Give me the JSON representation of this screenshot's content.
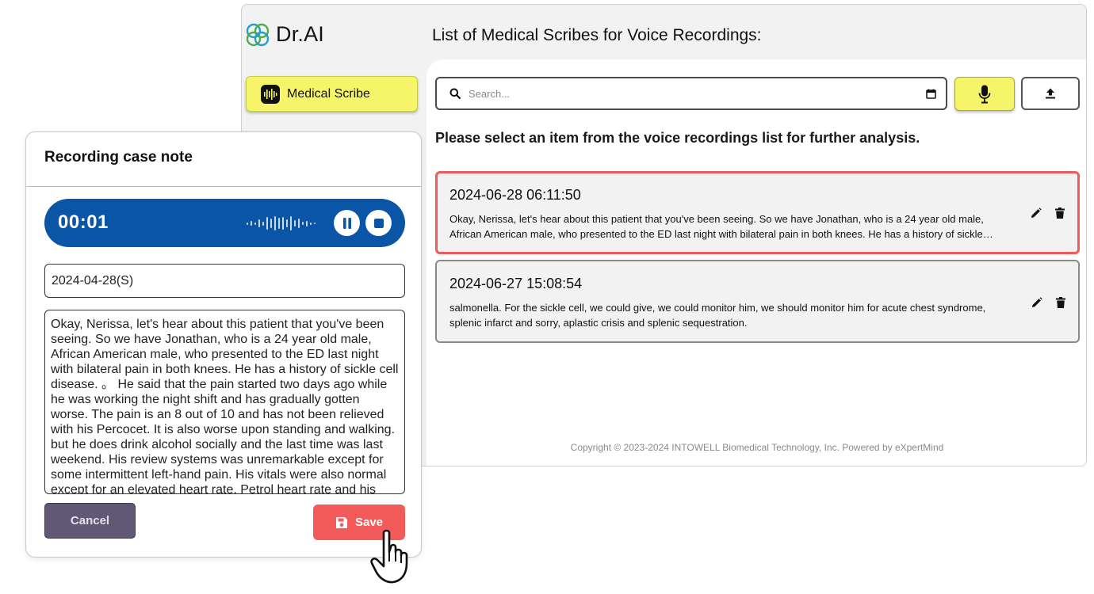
{
  "app": {
    "brand_name": "Dr.AI",
    "page_title": "List of Medical Scribes for Voice Recordings:",
    "nav": [
      {
        "label": "Medical Scribe",
        "icon": "audio-wave-icon",
        "active": true
      }
    ]
  },
  "search": {
    "placeholder": "Search...",
    "value": "",
    "calendar_icon": "calendar-icon"
  },
  "toolbar": {
    "record_icon": "microphone-icon",
    "upload_icon": "upload-icon"
  },
  "instruction": "Please select an item from the voice recordings list for further analysis.",
  "recordings": [
    {
      "timestamp": "2024-06-28 06:11:50",
      "text": "Okay, Nerissa, let's hear about this patient that you've been seeing. So we have Jonathan, who is a 24 year old male, African American male, who presented to the ED last night with bilateral pain in both knees. He has a history of sickle…",
      "selected": true
    },
    {
      "timestamp": "2024-06-27 15:08:54",
      "text": "salmonella. For the sickle cell, we could give, we could monitor him, we should monitor him for acute chest syndrome, splenic infarct and sorry, aplastic crisis and splenic sequestration.",
      "selected": false
    }
  ],
  "footer": "Copyright © 2023-2024 INTOWELL Biomedical Technology, Inc. Powered by eXpertMind",
  "modal": {
    "title": "Recording case note",
    "timer": "00:01",
    "date_value": "2024-04-28(S)",
    "note_text": "Okay, Nerissa, let's hear about this patient that you've been seeing. So we have Jonathan, who is a 24 year old male, African American male, who presented to the ED last night with bilateral pain in both knees. He has a history of sickle cell disease. 。 He said that the pain started two days ago while he was working the night shift and has gradually gotten worse. The pain is an 8 out of 10 and has not been relieved with his Percocet. It is also worse upon standing and walking. but he does drink alcohol socially and the last time was last weekend. His review systems was unremarkable except for some intermittent left-hand pain. His vitals were also normal except for an elevated heart rate. Petrol heart rate and his",
    "cancel_label": "Cancel",
    "save_label": "Save"
  },
  "colors": {
    "accent_yellow": "#f6f56a",
    "record_blue": "#0b55a6",
    "save_red": "#f35b5b",
    "selected_border": "#f05a5a",
    "cancel_purple": "#605874"
  }
}
